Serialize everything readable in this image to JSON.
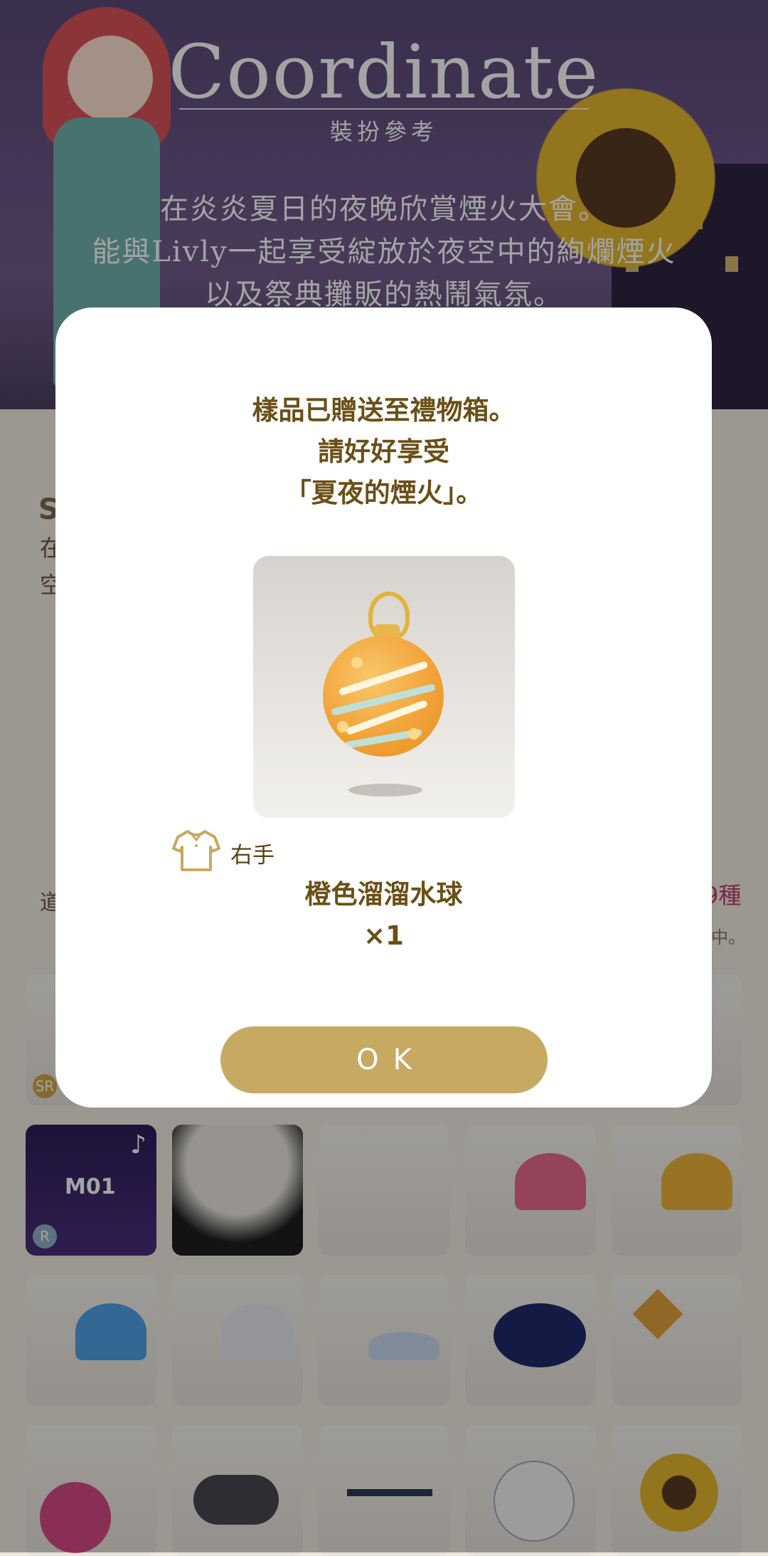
{
  "background": {
    "title": "Coordinate",
    "subtitle": "裝扮參考",
    "description_lines": [
      "在炎炎夏日的夜晚欣賞煙火大會。",
      "能與Livly一起享受綻放於夜空中的絢爛煙火",
      "以及祭典攤販的熱鬧氣氛。"
    ],
    "grid_tile_labels": [
      "SR",
      "M01",
      "R"
    ],
    "side_fragments": [
      "S",
      "在",
      "空",
      "道",
      "9種",
      "中。"
    ]
  },
  "modal": {
    "message_lines": [
      "樣品已贈送至禮物箱。",
      "請好好享受",
      "「夏夜的煙火」。"
    ],
    "item_icon": "orange-water-balloon-yoyo",
    "category_icon": "shirt-icon",
    "category_label": "右手",
    "item_name": "橙色溜溜水球",
    "quantity": "×1",
    "ok_label": "OK"
  },
  "colors": {
    "accent_gold": "#c8a962",
    "text_brown": "#6b4f17"
  }
}
